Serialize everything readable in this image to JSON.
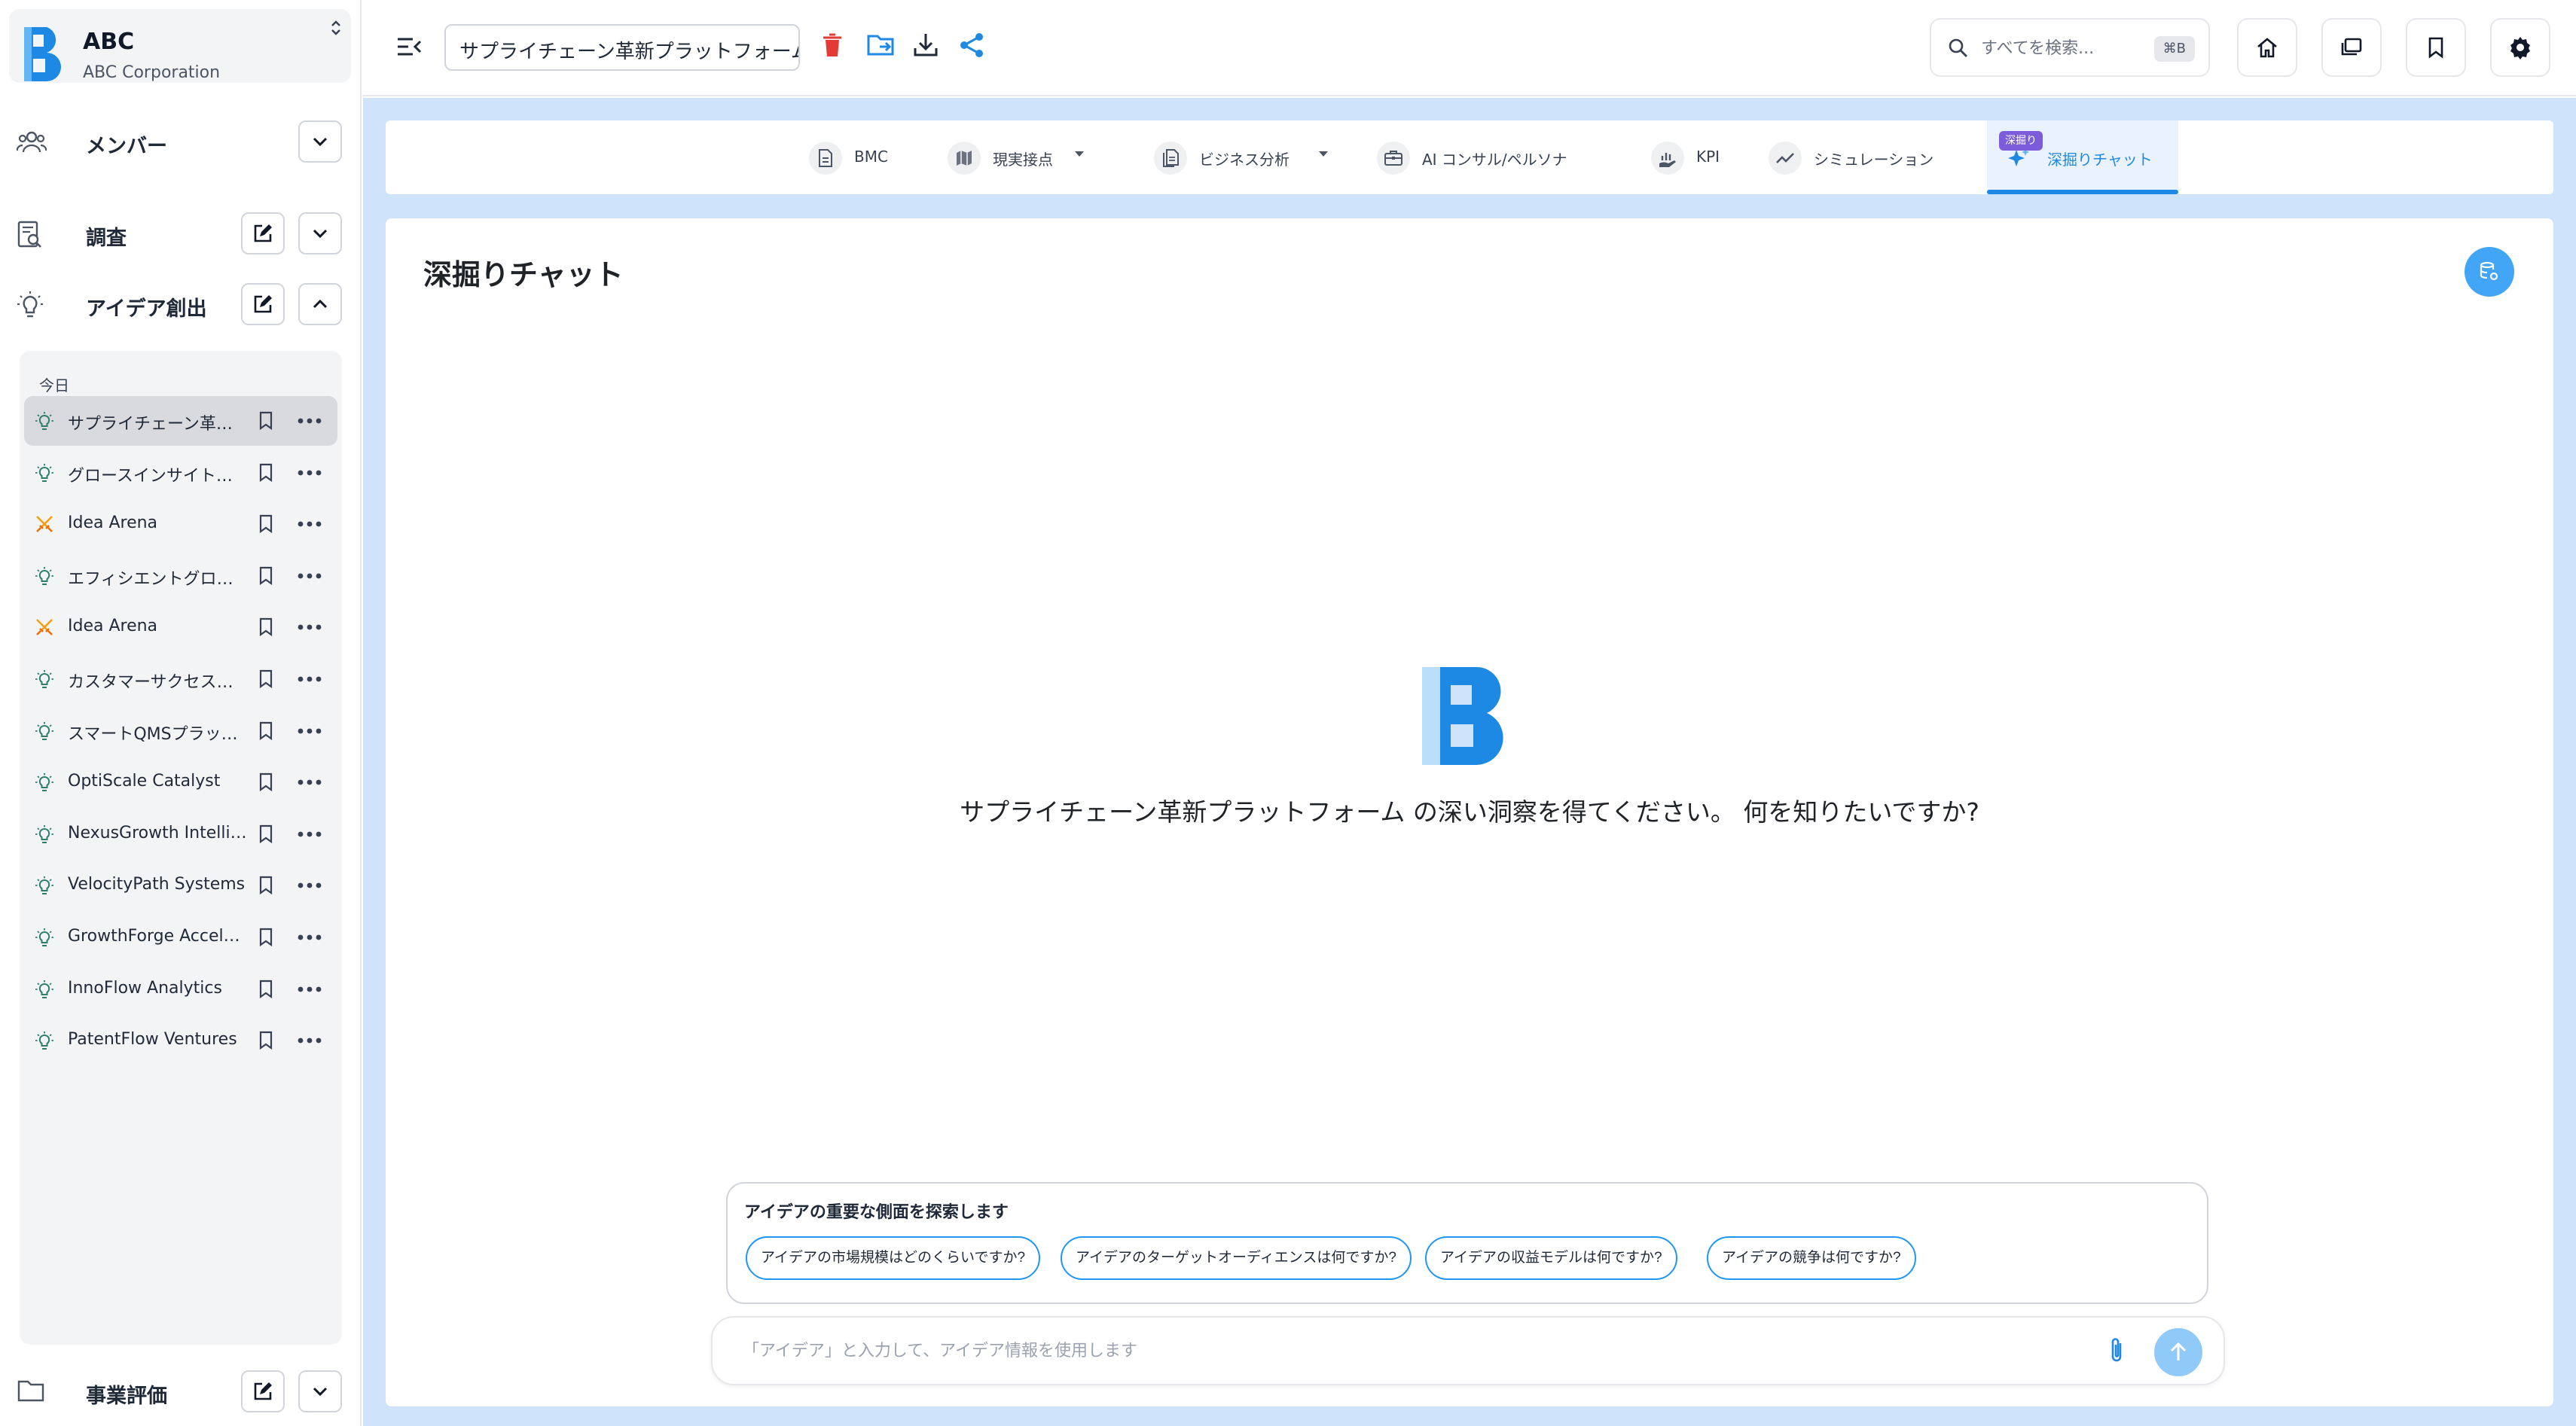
{
  "org": {
    "name": "ABC",
    "subtitle": "ABC Corporation"
  },
  "sidebar": {
    "sections": {
      "members": "メンバー",
      "research": "調査",
      "ideation": "アイデア創出",
      "evaluation": "事業評価"
    },
    "history_group": "今日",
    "history": [
      {
        "title": "サプライチェーン革新プラットフォーム",
        "icon": "lightbulb-icon",
        "active": true
      },
      {
        "title": "グロースインサイトアナリティクス",
        "icon": "lightbulb-icon"
      },
      {
        "title": "Idea Arena",
        "icon": "swords-icon"
      },
      {
        "title": "エフィシエントグロースソリューション",
        "icon": "lightbulb-icon"
      },
      {
        "title": "Idea Arena",
        "icon": "swords-icon"
      },
      {
        "title": "カスタマーサクセスプラットフォーム",
        "icon": "lightbulb-icon"
      },
      {
        "title": "スマートQMSプラットフォーム",
        "icon": "lightbulb-icon"
      },
      {
        "title": "OptiScale Catalyst",
        "icon": "lightbulb-icon"
      },
      {
        "title": "NexusGrowth Intelligence",
        "icon": "lightbulb-icon"
      },
      {
        "title": "VelocityPath Systems",
        "icon": "lightbulb-icon"
      },
      {
        "title": "GrowthForge Accelerator",
        "icon": "lightbulb-icon"
      },
      {
        "title": "InnoFlow Analytics",
        "icon": "lightbulb-icon"
      },
      {
        "title": "PatentFlow Ventures",
        "icon": "lightbulb-icon"
      }
    ]
  },
  "topbar": {
    "doc_title": "サプライチェーン革新プラットフォーム",
    "search_placeholder": "すべてを検索...",
    "search_shortcut": "⌘B"
  },
  "tabs": [
    {
      "label": "BMC",
      "icon": "document-icon"
    },
    {
      "label": "現実接点",
      "icon": "map-icon",
      "dropdown": true
    },
    {
      "label": "ビジネス分析",
      "icon": "files-icon",
      "dropdown": true
    },
    {
      "label": "AI コンサル/ペルソナ",
      "icon": "briefcase-icon"
    },
    {
      "label": "KPI",
      "icon": "chart-hand-icon"
    },
    {
      "label": "シミュレーション",
      "icon": "trend-icon"
    },
    {
      "label": "深掘りチャット",
      "icon": "sparkle-icon",
      "active": true,
      "badge": "深掘り"
    }
  ],
  "panel": {
    "title": "深掘りチャット",
    "prompt": "サプライチェーン革新プラットフォーム の深い洞察を得てください。 何を知りたいですか?"
  },
  "suggestions": {
    "title": "アイデアの重要な側面を探索します",
    "chips": [
      "アイデアの市場規模はどのくらいですか?",
      "アイデアのターゲットオーディエンスは何ですか?",
      "アイデアの収益モデルは何ですか?",
      "アイデアの競争は何ですか?"
    ]
  },
  "chat_input": {
    "placeholder": "「アイデア」と入力して、アイデア情報を使用します"
  },
  "colors": {
    "accent": "#1e88e5",
    "main_bg": "#cfe4fb",
    "delete": "#e53935",
    "badge": "#7c5cdb"
  }
}
